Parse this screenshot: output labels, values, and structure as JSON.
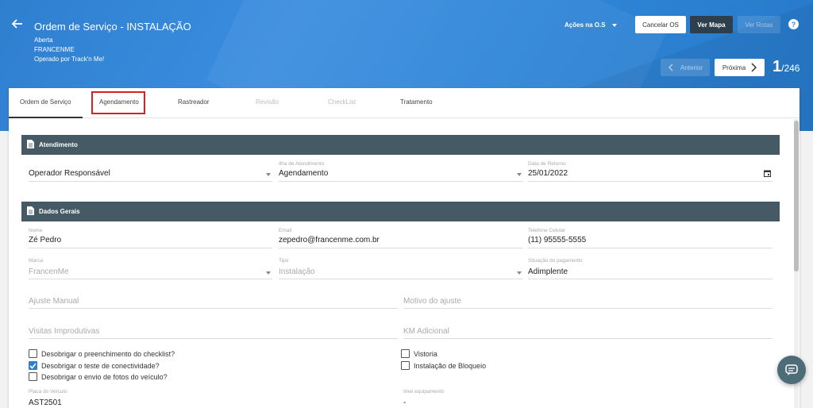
{
  "header": {
    "title": "Ordem de Serviço - INSTALAÇÃO",
    "status": "Aberta",
    "company": "FRANCENME",
    "operated_by": "Operado por Track'n Me!",
    "actions_label": "Ações na O.S",
    "cancel_label": "Cancelar OS",
    "map_label": "Ver Mapa",
    "routes_label": "Ver Rotas",
    "help": "?",
    "prev_label": "Anterior",
    "next_label": "Próxima",
    "page_current": "1",
    "page_total": "/246"
  },
  "tabs": [
    {
      "label": "Ordem de Serviço"
    },
    {
      "label": "Agendamento"
    },
    {
      "label": "Rastreador"
    },
    {
      "label": "Revisão"
    },
    {
      "label": "CheckList"
    },
    {
      "label": "Tratamento"
    }
  ],
  "atendimento": {
    "title": "Atendimento",
    "operador_value": "Operador Responsável",
    "ilha_label": "Ilha de Atendimento",
    "ilha_value": "Agendamento",
    "retorno_label": "Data de Retorno",
    "retorno_value": "25/01/2022"
  },
  "dados_gerais": {
    "title": "Dados Gerais",
    "nome_label": "Nome",
    "nome_value": "Zé Pedro",
    "email_label": "Email",
    "email_value": "zepedro@francenme.com.br",
    "telefone_label": "Telefone Celular",
    "telefone_value": "(11) 95555-5555",
    "marca_label": "Marca",
    "marca_value": "FrancenMe",
    "tipo_label": "Tipo",
    "tipo_value": "Instalação",
    "pagamento_label": "Situação do pagamento",
    "pagamento_value": "Adimplente",
    "ajuste_manual_ph": "Ajuste Manual",
    "motivo_ajuste_ph": "Motivo do ajuste",
    "visitas_ph": "Visitas Improdutivas",
    "km_ph": "KM Adicional",
    "placa_label": "Placa do Veículo",
    "placa_value": "AST2501",
    "imei_label": "Imei equipamento",
    "imei_value": "-"
  },
  "checkboxes": [
    {
      "label": "Desobrigar o preenchimento do checklist?",
      "checked": false
    },
    {
      "label": "Desobrigar o teste de conectividade?",
      "checked": true
    },
    {
      "label": "Desobrigar o envio de fotos do veículo?",
      "checked": false
    },
    {
      "label": "Vistoria",
      "checked": false
    },
    {
      "label": "Instalação de Bloqueio",
      "checked": false
    }
  ],
  "colors": {
    "header_blue": "#3a8ee0",
    "section_bar": "#455a64",
    "checkbox_on": "#2b7fd4",
    "highlight_red": "#d62222"
  }
}
